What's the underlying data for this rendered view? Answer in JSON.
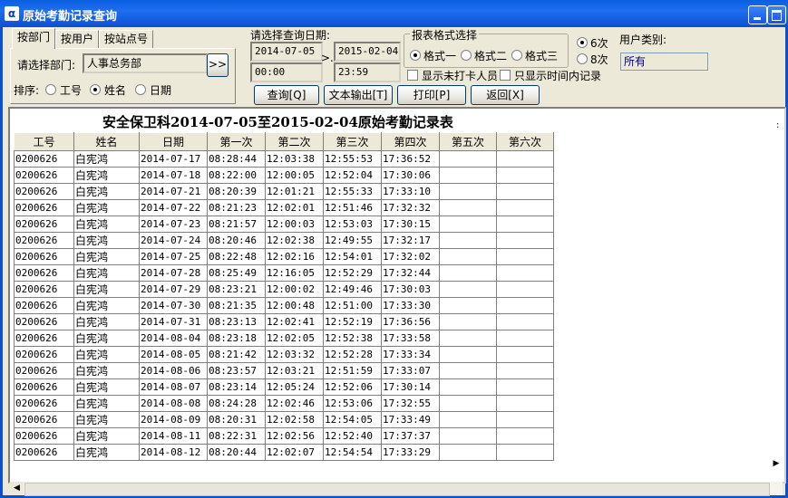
{
  "window": {
    "title": "原始考勤记录查询",
    "app_icon": "α"
  },
  "tabs": [
    {
      "label": "按部门",
      "active": true
    },
    {
      "label": "按用户",
      "active": false
    },
    {
      "label": "按站点号",
      "active": false
    }
  ],
  "department": {
    "label": "请选择部门:",
    "value": "人事总务部",
    "pick_button": ">>"
  },
  "sort": {
    "label": "排序:",
    "options": [
      {
        "label": "工号",
        "selected": false
      },
      {
        "label": "姓名",
        "selected": true
      },
      {
        "label": "日期",
        "selected": false
      }
    ]
  },
  "date_query": {
    "label": "请选择查询日期:",
    "start_date": "2014-07-05",
    "end_date": "2015-02-04",
    "start_time": "00:00",
    "end_time": "23:59",
    "separator": ">."
  },
  "format": {
    "label": "报表格式选择",
    "options": [
      {
        "label": "格式一",
        "selected": true
      },
      {
        "label": "格式二",
        "selected": false
      },
      {
        "label": "格式三",
        "selected": false
      }
    ]
  },
  "times": {
    "options": [
      {
        "label": "6次",
        "selected": true
      },
      {
        "label": "8次",
        "selected": false
      }
    ]
  },
  "checks": {
    "show_absent": "显示未打卡人员",
    "only_in_time": "只显示时间内记录"
  },
  "user_type": {
    "label": "用户类别:",
    "value": "所有"
  },
  "buttons": {
    "query": "查询[Q]",
    "text_export": "文本输出[T]",
    "print": "打印[P]",
    "back": "返回[X]"
  },
  "report": {
    "title": "安全保卫科2014-07-05至2015-02-04原始考勤记录表",
    "right_marker": ":",
    "columns": [
      "工号",
      "姓名",
      "日期",
      "第一次",
      "第二次",
      "第三次",
      "第四次",
      "第五次",
      "第六次"
    ],
    "rows": [
      [
        "0200626",
        "白宪鸿",
        "2014-07-17",
        "08:28:44",
        "12:03:38",
        "12:55:53",
        "17:36:52",
        "",
        ""
      ],
      [
        "0200626",
        "白宪鸿",
        "2014-07-18",
        "08:22:00",
        "12:00:05",
        "12:52:04",
        "17:30:06",
        "",
        ""
      ],
      [
        "0200626",
        "白宪鸿",
        "2014-07-21",
        "08:20:39",
        "12:01:21",
        "12:55:33",
        "17:33:10",
        "",
        ""
      ],
      [
        "0200626",
        "白宪鸿",
        "2014-07-22",
        "08:21:23",
        "12:02:01",
        "12:51:46",
        "17:32:32",
        "",
        ""
      ],
      [
        "0200626",
        "白宪鸿",
        "2014-07-23",
        "08:21:57",
        "12:00:03",
        "12:53:03",
        "17:30:15",
        "",
        ""
      ],
      [
        "0200626",
        "白宪鸿",
        "2014-07-24",
        "08:20:46",
        "12:02:38",
        "12:49:55",
        "17:32:17",
        "",
        ""
      ],
      [
        "0200626",
        "白宪鸿",
        "2014-07-25",
        "08:22:48",
        "12:02:16",
        "12:54:01",
        "17:32:02",
        "",
        ""
      ],
      [
        "0200626",
        "白宪鸿",
        "2014-07-28",
        "08:25:49",
        "12:16:05",
        "12:52:29",
        "17:32:44",
        "",
        ""
      ],
      [
        "0200626",
        "白宪鸿",
        "2014-07-29",
        "08:23:21",
        "12:00:02",
        "12:49:46",
        "17:30:03",
        "",
        ""
      ],
      [
        "0200626",
        "白宪鸿",
        "2014-07-30",
        "08:21:35",
        "12:00:48",
        "12:51:00",
        "17:33:30",
        "",
        ""
      ],
      [
        "0200626",
        "白宪鸿",
        "2014-07-31",
        "08:23:13",
        "12:02:41",
        "12:52:19",
        "17:36:56",
        "",
        ""
      ],
      [
        "0200626",
        "白宪鸿",
        "2014-08-04",
        "08:23:18",
        "12:02:05",
        "12:52:38",
        "17:33:58",
        "",
        ""
      ],
      [
        "0200626",
        "白宪鸿",
        "2014-08-05",
        "08:21:42",
        "12:03:32",
        "12:52:28",
        "17:33:34",
        "",
        ""
      ],
      [
        "0200626",
        "白宪鸿",
        "2014-08-06",
        "08:23:57",
        "12:03:21",
        "12:51:59",
        "17:33:07",
        "",
        ""
      ],
      [
        "0200626",
        "白宪鸿",
        "2014-08-07",
        "08:23:14",
        "12:05:24",
        "12:52:06",
        "17:30:14",
        "",
        ""
      ],
      [
        "0200626",
        "白宪鸿",
        "2014-08-08",
        "08:24:28",
        "12:02:46",
        "12:53:06",
        "17:32:55",
        "",
        ""
      ],
      [
        "0200626",
        "白宪鸿",
        "2014-08-09",
        "08:20:31",
        "12:02:58",
        "12:54:05",
        "17:33:49",
        "",
        ""
      ],
      [
        "0200626",
        "白宪鸿",
        "2014-08-11",
        "08:22:31",
        "12:02:56",
        "12:52:40",
        "17:37:37",
        "",
        ""
      ],
      [
        "0200626",
        "白宪鸿",
        "2014-08-12",
        "08:20:44",
        "12:02:07",
        "12:54:54",
        "17:33:29",
        "",
        ""
      ]
    ]
  },
  "scroll": {
    "left_arrow": "◀",
    "right_arrow": "▶"
  }
}
